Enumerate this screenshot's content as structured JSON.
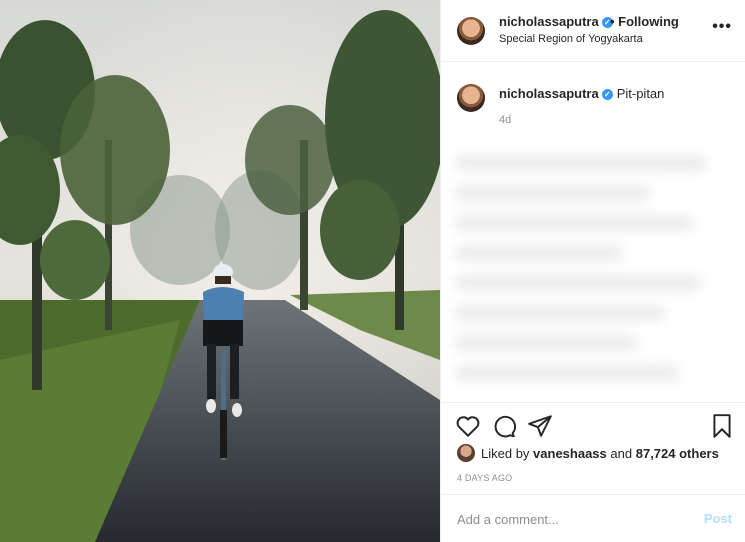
{
  "post": {
    "username": "nicholassaputra",
    "following_label": "Following",
    "location": "Special Region of Yogyakarta",
    "more_icon": "more-horizontal-icon",
    "caption": {
      "username": "nicholassaputra",
      "text": "Pit-pitan",
      "time_ago": "4d"
    },
    "actions": {
      "like_icon": "heart-icon",
      "comment_icon": "comment-icon",
      "share_icon": "paper-plane-icon",
      "save_icon": "bookmark-icon"
    },
    "likes": {
      "prefix": "Liked by",
      "user": "vaneshaass",
      "joiner": "and",
      "others": "87,724 others"
    },
    "date": "4 DAYS AGO",
    "comment": {
      "placeholder": "Add a comment...",
      "post_label": "Post"
    },
    "colors": {
      "verified": "#3897f0",
      "post_disabled": "#b2dffc",
      "muted": "#8e8e8e"
    }
  }
}
